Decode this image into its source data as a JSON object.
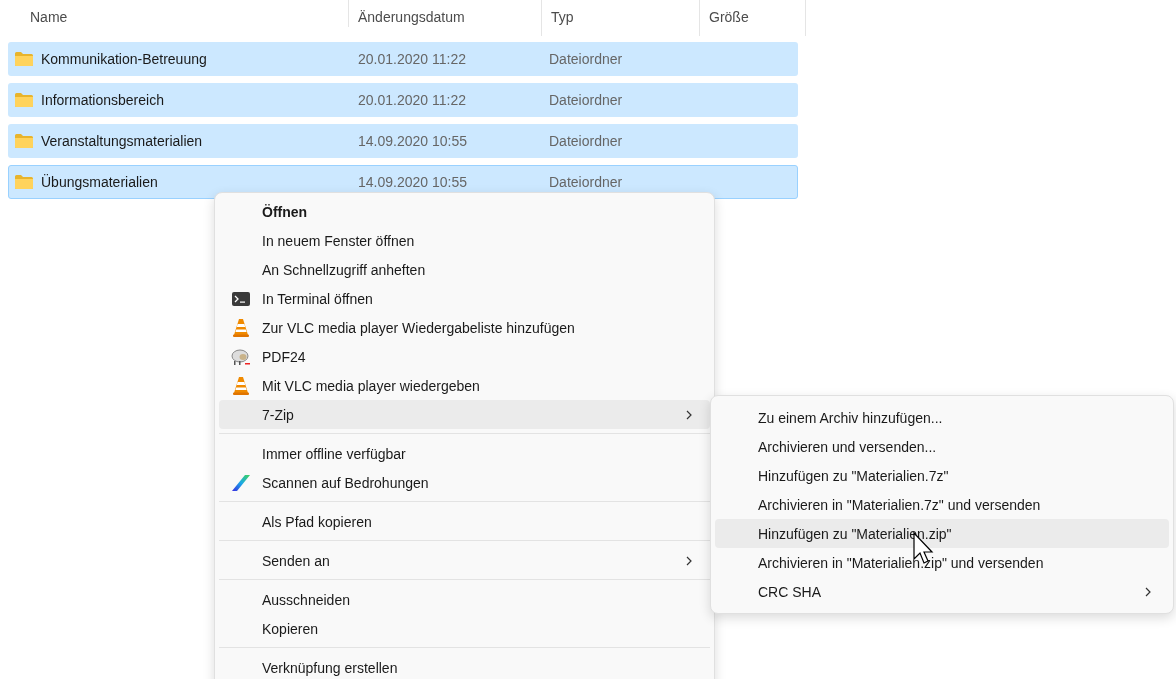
{
  "table": {
    "columns": [
      "Name",
      "Änderungsdatum",
      "Typ",
      "Größe"
    ],
    "rows": [
      {
        "name": "Kommunikation-Betreuung",
        "date": "20.01.2020 11:22",
        "type": "Dateiordner",
        "selected": true,
        "focused": false
      },
      {
        "name": "Informationsbereich",
        "date": "20.01.2020 11:22",
        "type": "Dateiordner",
        "selected": true,
        "focused": false
      },
      {
        "name": "Veranstaltungsmaterialien",
        "date": "14.09.2020 10:55",
        "type": "Dateiordner",
        "selected": true,
        "focused": false
      },
      {
        "name": "Übungsmaterialien",
        "date": "14.09.2020 10:55",
        "type": "Dateiordner",
        "selected": true,
        "focused": true
      }
    ]
  },
  "context_menu": {
    "items": [
      {
        "kind": "item",
        "label": "Öffnen",
        "bold": true,
        "submenu": false,
        "selected": false
      },
      {
        "kind": "item",
        "label": "In neuem Fenster öffnen",
        "bold": false,
        "submenu": false,
        "selected": false
      },
      {
        "kind": "item",
        "label": "An Schnellzugriff anheften",
        "bold": false,
        "submenu": false,
        "selected": false
      },
      {
        "kind": "terminal",
        "label": "In Terminal öffnen",
        "bold": false,
        "submenu": false,
        "selected": false
      },
      {
        "kind": "cone",
        "label": "Zur VLC media player Wiedergabeliste hinzufügen",
        "bold": false,
        "submenu": false,
        "selected": false
      },
      {
        "kind": "sheep",
        "label": "PDF24",
        "bold": false,
        "submenu": false,
        "selected": false
      },
      {
        "kind": "cone",
        "label": "Mit VLC media player wiedergeben",
        "bold": false,
        "submenu": false,
        "selected": false
      },
      {
        "kind": "item",
        "label": "7-Zip",
        "bold": false,
        "submenu": true,
        "selected": true
      },
      {
        "kind": "separator"
      },
      {
        "kind": "item",
        "label": "Immer offline verfügbar",
        "bold": false,
        "submenu": false,
        "selected": false
      },
      {
        "kind": "stripe",
        "label": "Scannen auf Bedrohungen",
        "bold": false,
        "submenu": false,
        "selected": false
      },
      {
        "kind": "separator"
      },
      {
        "kind": "item",
        "label": "Als Pfad kopieren",
        "bold": false,
        "submenu": false,
        "selected": false
      },
      {
        "kind": "separator"
      },
      {
        "kind": "item",
        "label": "Senden an",
        "bold": false,
        "submenu": true,
        "selected": false
      },
      {
        "kind": "separator"
      },
      {
        "kind": "item",
        "label": "Ausschneiden",
        "bold": false,
        "submenu": false,
        "selected": false
      },
      {
        "kind": "item",
        "label": "Kopieren",
        "bold": false,
        "submenu": false,
        "selected": false
      },
      {
        "kind": "separator"
      },
      {
        "kind": "item",
        "label": "Verknüpfung erstellen",
        "bold": false,
        "submenu": false,
        "selected": false
      }
    ]
  },
  "submenu": {
    "items": [
      {
        "label": "Zu einem Archiv hinzufügen...",
        "submenu": false,
        "selected": false
      },
      {
        "label": "Archivieren und versenden...",
        "submenu": false,
        "selected": false
      },
      {
        "label": "Hinzufügen zu \"Materialien.7z\"",
        "submenu": false,
        "selected": false
      },
      {
        "label": "Archivieren in \"Materialien.7z\" und versenden",
        "submenu": false,
        "selected": false
      },
      {
        "label": "Hinzufügen zu \"Materialien.zip\"",
        "submenu": false,
        "selected": true
      },
      {
        "label": "Archivieren in \"Materialien.zip\" und versenden",
        "submenu": false,
        "selected": false
      },
      {
        "label": "CRC SHA",
        "submenu": true,
        "selected": false
      }
    ]
  }
}
